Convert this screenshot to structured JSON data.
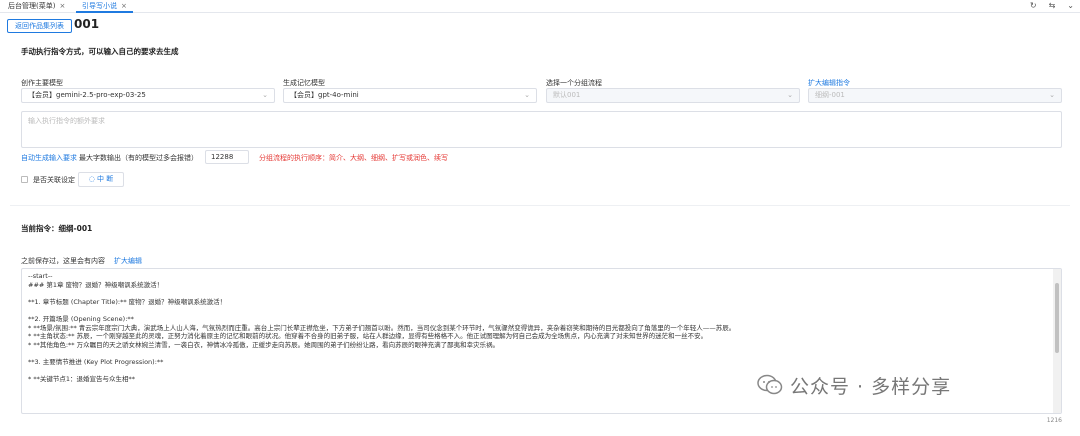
{
  "tabs": [
    {
      "label": "后台管理(菜单)",
      "close": "×"
    },
    {
      "label": "引导写小说",
      "close": "×"
    }
  ],
  "toolbar_icons": [
    "refresh-icon",
    "swap-icon",
    "chevron-down-icon"
  ],
  "header": {
    "back_label": "返回作品集列表",
    "title": "001"
  },
  "section_manual": "手动执行指令方式，可以输入自己的要求去生成",
  "fields": [
    {
      "label": "创作主要模型",
      "value": "【会员】gemini-2.5-pro-exp-03-25",
      "disabled": false
    },
    {
      "label": "生成记忆模型",
      "value": "【会员】gpt-4o-mini",
      "disabled": false
    },
    {
      "label": "选择一个分组流程",
      "value": "默认001",
      "disabled": true
    },
    {
      "label": "扩大编辑指令",
      "value": "细纲-001",
      "disabled": true
    }
  ],
  "instruction_placeholder": "输入执行指令的额外要求",
  "auto_gen_link": "自动生成输入要求",
  "max_output_label": "最大字数输出（有的模型过多会报错）",
  "max_output_value": "12288",
  "order_note": "分组流程的执行顺序：简介、大纲、细纲、扩写或润色、续写",
  "association_label": "是否关联设定",
  "stop_label": "中 断",
  "current_instruction": "当前指令：细纲-001",
  "saved_label": "之前保存过，这里会有内容",
  "expand_edit": "扩大编辑",
  "content_lines": [
    "--start--",
    "### 第1章 废物？退婚？神级嘲讽系统激活！",
    "",
    "**1. 章节标题 (Chapter Title):** 废物？退婚？神级嘲讽系统激活！",
    "",
    "**2. 开篇场景 (Opening Scene):**",
    "    *   **场景/氛围:** 青云宗年度宗门大典，演武场上人山人海，气氛热烈而庄重。高台上宗门长辈正襟危坐，下方弟子们翘首以盼。然而，当司仪念到某个环节时，气氛骤然变得诡异，夹杂着窃笑和期待的目光都投向了角落里的一个年轻人——苏辰。",
    "    *   **主角状态:** 苏辰，一个刚穿越至此的灵魂，正努力消化着原主的记忆和眼前的状况。他穿着不合身的旧弟子服，站在人群边缘，显得有些格格不入。他正试图理解为何自己会成为全场焦点，内心充满了对未知世界的迷茫和一丝不安。",
    "    *   **其他角色:** 万众瞩目的天之骄女林婉兰清雪，一袭白衣，神情冰冷孤傲，正缓步走向苏辰。她周围的弟子们纷纷让路，看向苏辰的眼神充满了鄙夷和幸灾乐祸。",
    "",
    "**3. 主要情节推进 (Key Plot Progression):**",
    "",
    "    *   **关键节点1：退婚宣告与众生相**"
  ],
  "counter": "1216",
  "watermark": "公众号 · 多样分享"
}
